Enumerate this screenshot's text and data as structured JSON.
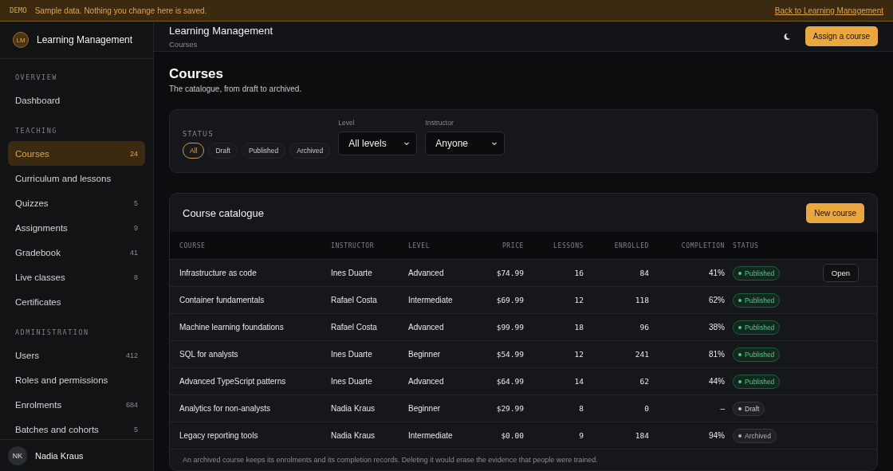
{
  "banner": {
    "tag": "DEMO",
    "message": "Sample data. Nothing you change here is saved.",
    "link": "Back to Learning Management"
  },
  "sidebar": {
    "brand": {
      "initials": "LM",
      "name": "Learning Management"
    },
    "sections": [
      {
        "title": "OVERVIEW",
        "items": [
          {
            "label": "Dashboard",
            "selected": false
          }
        ]
      },
      {
        "title": "TEACHING",
        "items": [
          {
            "label": "Courses",
            "count": "24",
            "selected": true
          },
          {
            "label": "Curriculum and lessons",
            "selected": false
          },
          {
            "label": "Quizzes",
            "count": "5",
            "selected": false
          },
          {
            "label": "Assignments",
            "count": "9",
            "selected": false
          },
          {
            "label": "Gradebook",
            "count": "41",
            "selected": false
          },
          {
            "label": "Live classes",
            "count": "8",
            "selected": false
          },
          {
            "label": "Certificates",
            "selected": false
          }
        ]
      },
      {
        "title": "ADMINISTRATION",
        "items": [
          {
            "label": "Users",
            "count": "412",
            "selected": false
          },
          {
            "label": "Roles and permissions",
            "selected": false
          },
          {
            "label": "Enrolments",
            "count": "684",
            "selected": false
          },
          {
            "label": "Batches and cohorts",
            "count": "5",
            "selected": false
          }
        ]
      }
    ],
    "user": {
      "initials": "NK",
      "name": "Nadia Kraus"
    }
  },
  "header": {
    "title": "Learning Management",
    "breadcrumb": "Courses",
    "action": "Assign a course"
  },
  "page": {
    "title": "Courses",
    "subtitle": "The catalogue, from draft to archived."
  },
  "filters": {
    "status_label": "STATUS",
    "statuses": [
      {
        "label": "All",
        "selected": true
      },
      {
        "label": "Draft",
        "selected": false
      },
      {
        "label": "Published",
        "selected": false
      },
      {
        "label": "Archived",
        "selected": false
      }
    ],
    "selects": [
      {
        "label": "Level",
        "value": "All levels"
      },
      {
        "label": "Instructor",
        "value": "Anyone"
      }
    ]
  },
  "table": {
    "title": "Course catalogue",
    "action": "New course",
    "columns": [
      "COURSE",
      "INSTRUCTOR",
      "LEVEL",
      "PRICE",
      "LESSONS",
      "ENROLLED",
      "COMPLETION",
      "STATUS"
    ],
    "rows": [
      {
        "cells": [
          "Infrastructure as code",
          "Ines Duarte",
          "Advanced",
          "$74.99",
          "16",
          "84",
          "41%"
        ],
        "status": "Published",
        "kind": "published",
        "action": "Open"
      },
      {
        "cells": [
          "Container fundamentals",
          "Rafael Costa",
          "Intermediate",
          "$69.99",
          "12",
          "118",
          "62%"
        ],
        "status": "Published",
        "kind": "published"
      },
      {
        "cells": [
          "Machine learning foundations",
          "Rafael Costa",
          "Advanced",
          "$99.99",
          "18",
          "96",
          "38%"
        ],
        "status": "Published",
        "kind": "published"
      },
      {
        "cells": [
          "SQL for analysts",
          "Ines Duarte",
          "Beginner",
          "$54.99",
          "12",
          "241",
          "81%"
        ],
        "status": "Published",
        "kind": "published"
      },
      {
        "cells": [
          "Advanced TypeScript patterns",
          "Ines Duarte",
          "Advanced",
          "$64.99",
          "14",
          "62",
          "44%"
        ],
        "status": "Published",
        "kind": "published"
      },
      {
        "cells": [
          "Analytics for non-analysts",
          "Nadia Kraus",
          "Beginner",
          "$29.99",
          "8",
          "0",
          "–"
        ],
        "status": "Draft",
        "kind": "draft"
      },
      {
        "cells": [
          "Legacy reporting tools",
          "Nadia Kraus",
          "Intermediate",
          "$0.00",
          "9",
          "184",
          "94%"
        ],
        "status": "Archived",
        "kind": "archived"
      }
    ],
    "footnote": "An archived course keeps its enrolments and its completion records. Deleting it would erase the evidence that people were trained."
  }
}
